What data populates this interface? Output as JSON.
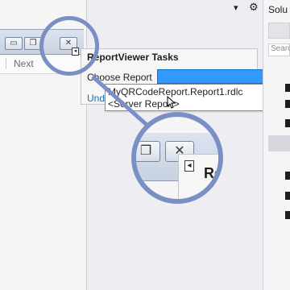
{
  "top_icons": {
    "pin": "▾",
    "gear": "⚙"
  },
  "report_viewer": {
    "window_buttons": {
      "minimize": "▭",
      "restore": "❐",
      "close": "✕"
    },
    "toolbar": {
      "next_label": "Next"
    }
  },
  "tasks_panel": {
    "title": "ReportViewer Tasks",
    "choose_report_label": "Choose Report",
    "selected_value": "",
    "dropdown_arrow": "⌵",
    "undock_link": "Und",
    "options": [
      "MyQRCodeReport.Report1.rdlc",
      "<Server Report>"
    ]
  },
  "solution_explorer": {
    "title": "Solu",
    "search_placeholder": "Searc"
  },
  "magnifier": {
    "label": "Re",
    "tag_glyph": "◂"
  },
  "colors": {
    "accent": "#0078d7",
    "selection": "#3399ff",
    "magnifier_ring": "#7a8fc4",
    "link": "#0e70c0"
  }
}
